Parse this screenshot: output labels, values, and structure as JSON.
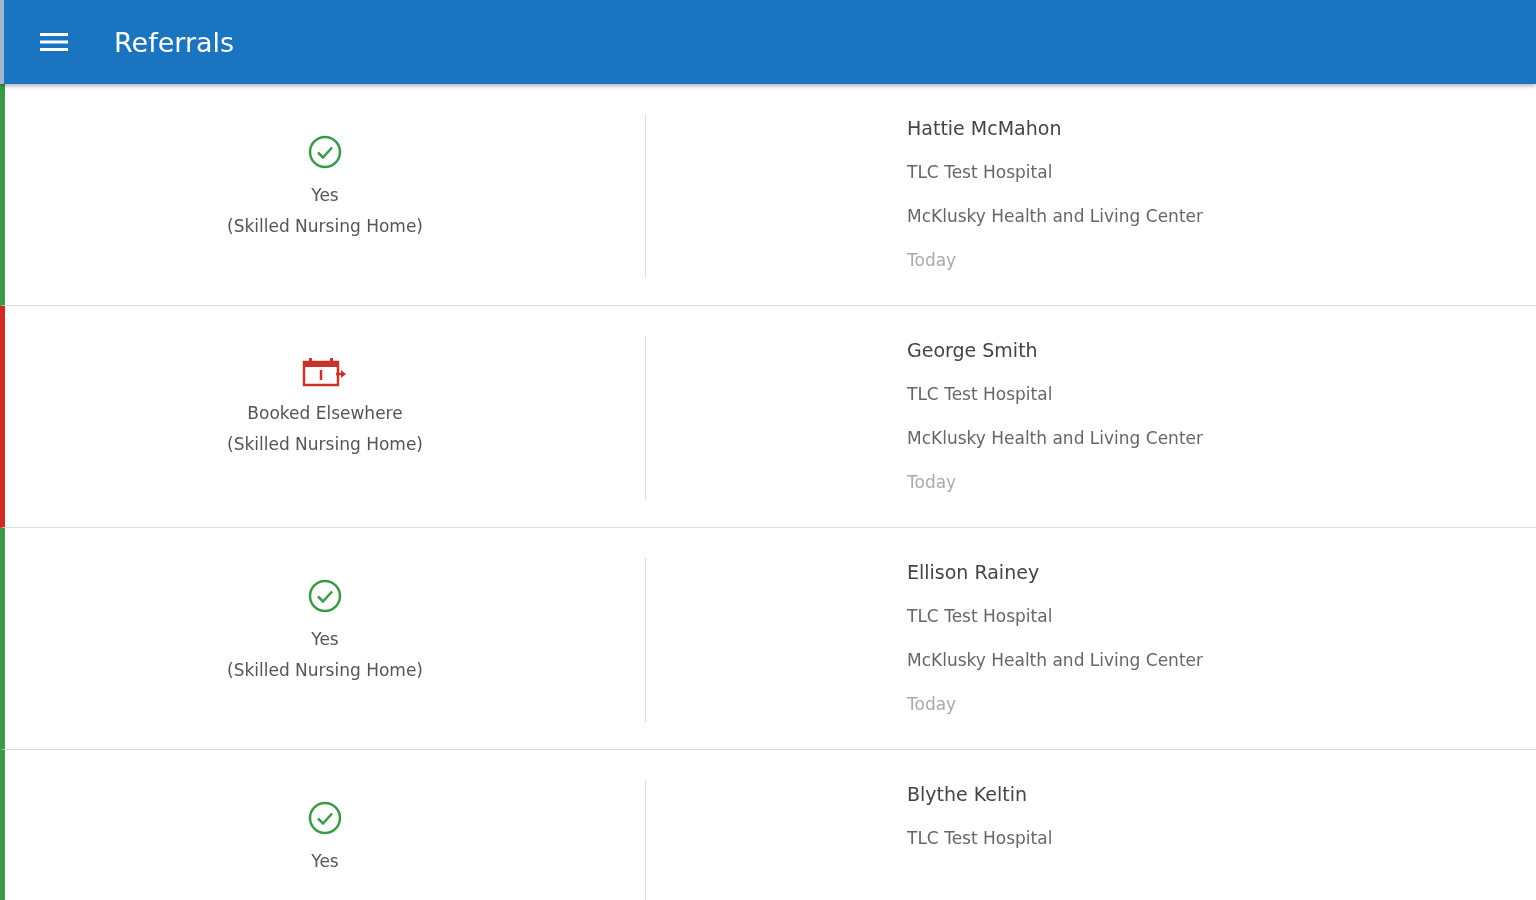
{
  "app_bar": {
    "title": "Referrals"
  },
  "referrals": [
    {
      "kind": "accepted",
      "status": "Yes",
      "facility_type": "(Skilled Nursing Home)",
      "patient": "Hattie McMahon",
      "hospital": "TLC Test Hospital",
      "facility": "McKlusky Health and Living Center",
      "date": "Today"
    },
    {
      "kind": "booked",
      "status": "Booked Elsewhere",
      "facility_type": "(Skilled Nursing Home)",
      "patient": "George Smith",
      "hospital": "TLC Test Hospital",
      "facility": "McKlusky Health and Living Center",
      "date": "Today"
    },
    {
      "kind": "accepted",
      "status": "Yes",
      "facility_type": "(Skilled Nursing Home)",
      "patient": "Ellison Rainey",
      "hospital": "TLC Test Hospital",
      "facility": "McKlusky Health and Living Center",
      "date": "Today"
    },
    {
      "kind": "accepted",
      "status": "Yes",
      "patient": "Blythe Keltin",
      "hospital": "TLC Test Hospital"
    }
  ]
}
